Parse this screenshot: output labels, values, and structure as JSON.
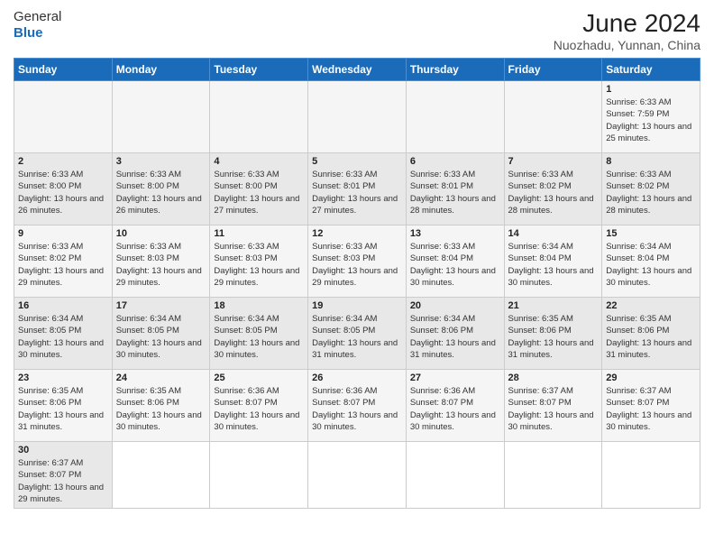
{
  "logo": {
    "text_general": "General",
    "text_blue": "Blue"
  },
  "title": "June 2024",
  "subtitle": "Nuozhadu, Yunnan, China",
  "headers": [
    "Sunday",
    "Monday",
    "Tuesday",
    "Wednesday",
    "Thursday",
    "Friday",
    "Saturday"
  ],
  "weeks": [
    {
      "days": [
        {
          "num": "",
          "info": ""
        },
        {
          "num": "",
          "info": ""
        },
        {
          "num": "",
          "info": ""
        },
        {
          "num": "",
          "info": ""
        },
        {
          "num": "",
          "info": ""
        },
        {
          "num": "",
          "info": ""
        },
        {
          "num": "1",
          "info": "Sunrise: 6:33 AM\nSunset: 7:59 PM\nDaylight: 13 hours and 25 minutes."
        }
      ]
    },
    {
      "days": [
        {
          "num": "2",
          "info": "Sunrise: 6:33 AM\nSunset: 8:00 PM\nDaylight: 13 hours and 26 minutes."
        },
        {
          "num": "3",
          "info": "Sunrise: 6:33 AM\nSunset: 8:00 PM\nDaylight: 13 hours and 26 minutes."
        },
        {
          "num": "4",
          "info": "Sunrise: 6:33 AM\nSunset: 8:00 PM\nDaylight: 13 hours and 27 minutes."
        },
        {
          "num": "5",
          "info": "Sunrise: 6:33 AM\nSunset: 8:01 PM\nDaylight: 13 hours and 27 minutes."
        },
        {
          "num": "6",
          "info": "Sunrise: 6:33 AM\nSunset: 8:01 PM\nDaylight: 13 hours and 28 minutes."
        },
        {
          "num": "7",
          "info": "Sunrise: 6:33 AM\nSunset: 8:02 PM\nDaylight: 13 hours and 28 minutes."
        },
        {
          "num": "8",
          "info": "Sunrise: 6:33 AM\nSunset: 8:02 PM\nDaylight: 13 hours and 28 minutes."
        }
      ]
    },
    {
      "days": [
        {
          "num": "9",
          "info": "Sunrise: 6:33 AM\nSunset: 8:02 PM\nDaylight: 13 hours and 29 minutes."
        },
        {
          "num": "10",
          "info": "Sunrise: 6:33 AM\nSunset: 8:03 PM\nDaylight: 13 hours and 29 minutes."
        },
        {
          "num": "11",
          "info": "Sunrise: 6:33 AM\nSunset: 8:03 PM\nDaylight: 13 hours and 29 minutes."
        },
        {
          "num": "12",
          "info": "Sunrise: 6:33 AM\nSunset: 8:03 PM\nDaylight: 13 hours and 29 minutes."
        },
        {
          "num": "13",
          "info": "Sunrise: 6:33 AM\nSunset: 8:04 PM\nDaylight: 13 hours and 30 minutes."
        },
        {
          "num": "14",
          "info": "Sunrise: 6:34 AM\nSunset: 8:04 PM\nDaylight: 13 hours and 30 minutes."
        },
        {
          "num": "15",
          "info": "Sunrise: 6:34 AM\nSunset: 8:04 PM\nDaylight: 13 hours and 30 minutes."
        }
      ]
    },
    {
      "days": [
        {
          "num": "16",
          "info": "Sunrise: 6:34 AM\nSunset: 8:05 PM\nDaylight: 13 hours and 30 minutes."
        },
        {
          "num": "17",
          "info": "Sunrise: 6:34 AM\nSunset: 8:05 PM\nDaylight: 13 hours and 30 minutes."
        },
        {
          "num": "18",
          "info": "Sunrise: 6:34 AM\nSunset: 8:05 PM\nDaylight: 13 hours and 30 minutes."
        },
        {
          "num": "19",
          "info": "Sunrise: 6:34 AM\nSunset: 8:05 PM\nDaylight: 13 hours and 31 minutes."
        },
        {
          "num": "20",
          "info": "Sunrise: 6:34 AM\nSunset: 8:06 PM\nDaylight: 13 hours and 31 minutes."
        },
        {
          "num": "21",
          "info": "Sunrise: 6:35 AM\nSunset: 8:06 PM\nDaylight: 13 hours and 31 minutes."
        },
        {
          "num": "22",
          "info": "Sunrise: 6:35 AM\nSunset: 8:06 PM\nDaylight: 13 hours and 31 minutes."
        }
      ]
    },
    {
      "days": [
        {
          "num": "23",
          "info": "Sunrise: 6:35 AM\nSunset: 8:06 PM\nDaylight: 13 hours and 31 minutes."
        },
        {
          "num": "24",
          "info": "Sunrise: 6:35 AM\nSunset: 8:06 PM\nDaylight: 13 hours and 30 minutes."
        },
        {
          "num": "25",
          "info": "Sunrise: 6:36 AM\nSunset: 8:07 PM\nDaylight: 13 hours and 30 minutes."
        },
        {
          "num": "26",
          "info": "Sunrise: 6:36 AM\nSunset: 8:07 PM\nDaylight: 13 hours and 30 minutes."
        },
        {
          "num": "27",
          "info": "Sunrise: 6:36 AM\nSunset: 8:07 PM\nDaylight: 13 hours and 30 minutes."
        },
        {
          "num": "28",
          "info": "Sunrise: 6:37 AM\nSunset: 8:07 PM\nDaylight: 13 hours and 30 minutes."
        },
        {
          "num": "29",
          "info": "Sunrise: 6:37 AM\nSunset: 8:07 PM\nDaylight: 13 hours and 30 minutes."
        }
      ]
    },
    {
      "days": [
        {
          "num": "30",
          "info": "Sunrise: 6:37 AM\nSunset: 8:07 PM\nDaylight: 13 hours and 29 minutes."
        },
        {
          "num": "",
          "info": ""
        },
        {
          "num": "",
          "info": ""
        },
        {
          "num": "",
          "info": ""
        },
        {
          "num": "",
          "info": ""
        },
        {
          "num": "",
          "info": ""
        },
        {
          "num": "",
          "info": ""
        }
      ]
    }
  ]
}
